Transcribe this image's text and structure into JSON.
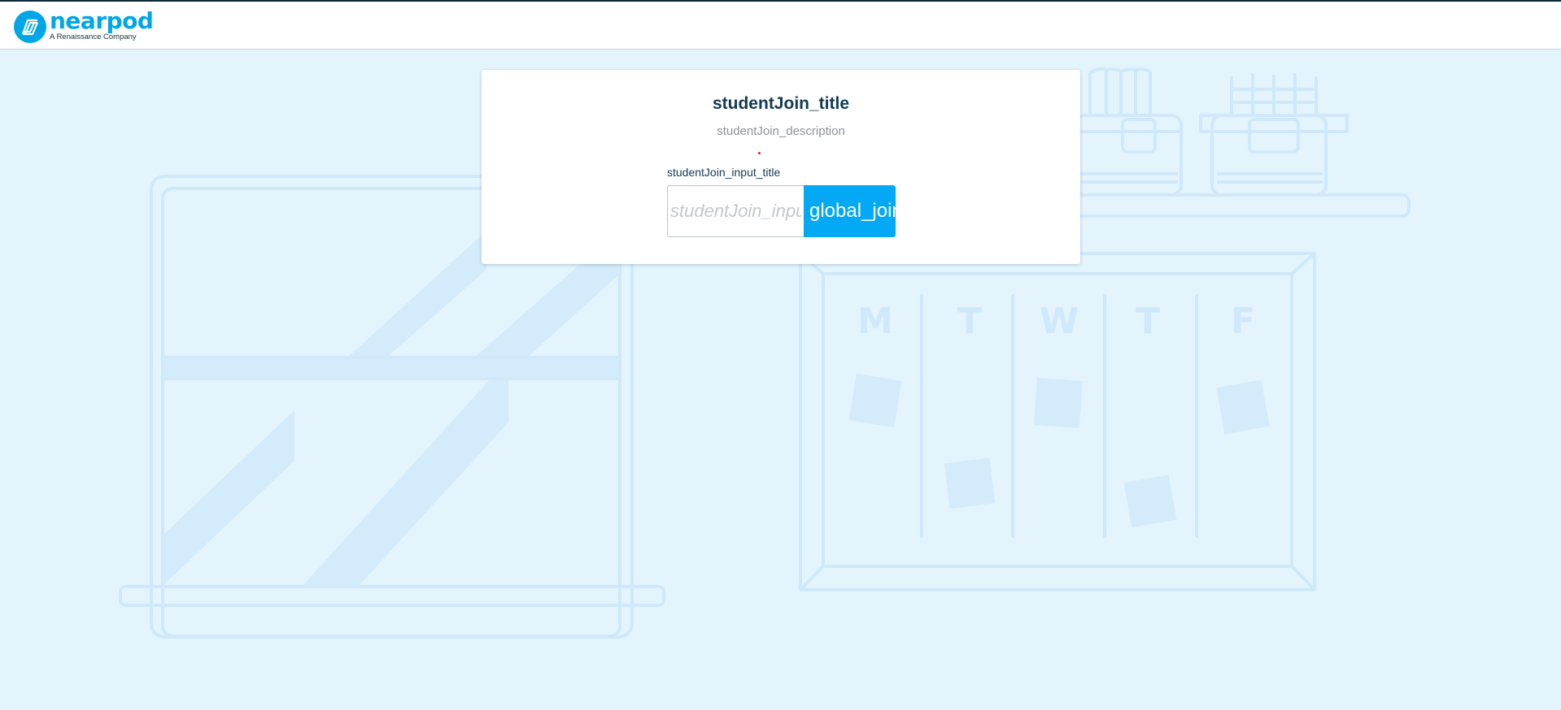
{
  "header": {
    "logo_word": "nearpod",
    "logo_subtitle": "A Renaissance Company"
  },
  "join_card": {
    "title": "studentJoin_title",
    "description": "studentJoin_description",
    "input_label": "studentJoin_input_title",
    "input_placeholder": "studentJoin_input_placeholder",
    "input_value": "",
    "join_button_label": "global_join"
  },
  "background": {
    "calendar_days": [
      "M",
      "T",
      "W",
      "T",
      "F"
    ]
  },
  "colors": {
    "brand": "#00a6e6",
    "button": "#03a9f4",
    "page_background": "#e3f4fd",
    "title_text": "#123a55",
    "error_dot": "#e02020"
  }
}
